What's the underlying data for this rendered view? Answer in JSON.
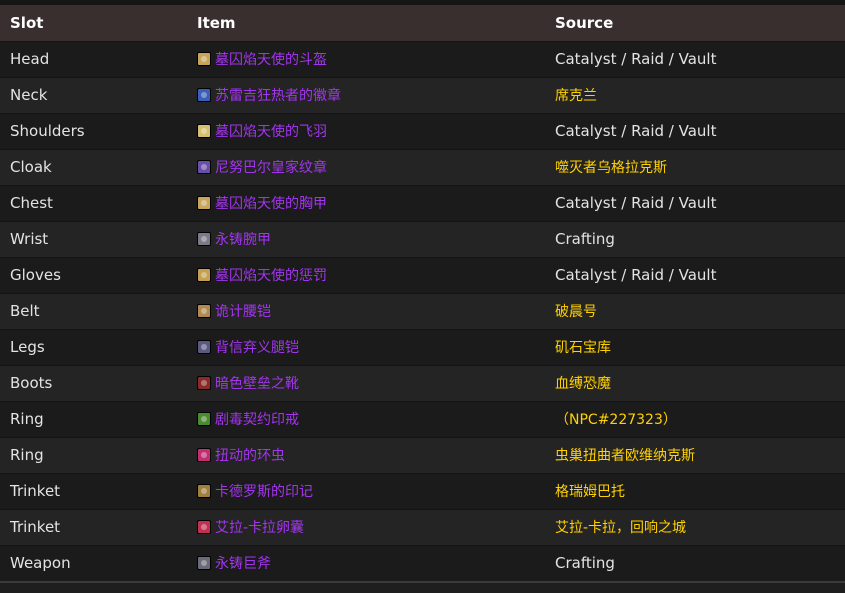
{
  "header": {
    "slot": "Slot",
    "item": "Item",
    "source": "Source"
  },
  "rows": [
    {
      "slot": "Head",
      "item": "墓囚焰天使的斗盔",
      "source": "Catalyst / Raid / Vault",
      "source_style": "plain",
      "icon_color": "#c8a45a"
    },
    {
      "slot": "Neck",
      "item": "苏雷吉狂热者的徽章",
      "source": "席克兰",
      "source_style": "link",
      "icon_color": "#3a5fb8"
    },
    {
      "slot": "Shoulders",
      "item": "墓囚焰天使的飞羽",
      "source": "Catalyst / Raid / Vault",
      "source_style": "plain",
      "icon_color": "#d4c070"
    },
    {
      "slot": "Cloak",
      "item": "尼努巴尔皇家纹章",
      "source": "噬灭者乌格拉克斯",
      "source_style": "link",
      "icon_color": "#6a4fa8"
    },
    {
      "slot": "Chest",
      "item": "墓囚焰天使的胸甲",
      "source": "Catalyst / Raid / Vault",
      "source_style": "plain",
      "icon_color": "#c9a55e"
    },
    {
      "slot": "Wrist",
      "item": "永铸腕甲",
      "source": "Crafting",
      "source_style": "plain",
      "icon_color": "#7a7a88"
    },
    {
      "slot": "Gloves",
      "item": "墓囚焰天使的惩罚",
      "source": "Catalyst / Raid / Vault",
      "source_style": "plain",
      "icon_color": "#c4a050"
    },
    {
      "slot": "Belt",
      "item": "诡计腰铠",
      "source": "破晨号",
      "source_style": "link",
      "icon_color": "#b08a50"
    },
    {
      "slot": "Legs",
      "item": "背信弃义腿铠",
      "source": "矶石宝库",
      "source_style": "link",
      "icon_color": "#5a5a80"
    },
    {
      "slot": "Boots",
      "item": "暗色壁垒之靴",
      "source": "血缚恐魔",
      "source_style": "link",
      "icon_color": "#8a2a2a"
    },
    {
      "slot": "Ring",
      "item": "剧毒契约印戒",
      "source": "（NPC#227323）",
      "source_style": "link",
      "icon_color": "#4a8a30"
    },
    {
      "slot": "Ring",
      "item": "扭动的环虫",
      "source": "虫巢扭曲者欧维纳克斯",
      "source_style": "link",
      "icon_color": "#c03070"
    },
    {
      "slot": "Trinket",
      "item": "卡德罗斯的印记",
      "source": "格瑞姆巴托",
      "source_style": "link",
      "icon_color": "#a08040"
    },
    {
      "slot": "Trinket",
      "item": "艾拉-卡拉卵囊",
      "source": "艾拉-卡拉，回响之城",
      "source_style": "link",
      "icon_color": "#c03050"
    },
    {
      "slot": "Weapon",
      "item": "永铸巨斧",
      "source": "Crafting",
      "source_style": "plain",
      "icon_color": "#6a6a78"
    }
  ]
}
